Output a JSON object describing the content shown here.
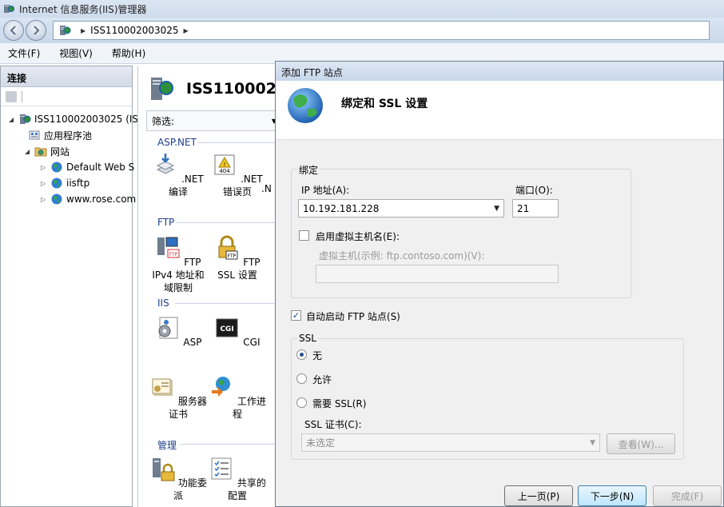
{
  "window": {
    "title": "Internet 信息服务(IIS)管理器"
  },
  "address": {
    "path": "ISS110002003025"
  },
  "menu": [
    "文件(F)",
    "视图(V)",
    "帮助(H)"
  ],
  "connections": {
    "header": "连接",
    "tree": [
      {
        "label": "ISS110002003025 (IS",
        "icon": "server-icon",
        "level": 0,
        "expander": "expanded"
      },
      {
        "label": "应用程序池",
        "icon": "app-pool-icon",
        "level": 1,
        "expander": "none"
      },
      {
        "label": "网站",
        "icon": "sites-folder-icon",
        "level": 1,
        "expander": "expanded"
      },
      {
        "label": "Default Web S",
        "icon": "globe-icon",
        "level": 2,
        "expander": "collapsed"
      },
      {
        "label": "iisftp",
        "icon": "globe-icon",
        "level": 2,
        "expander": "collapsed"
      },
      {
        "label": "www.rose.com",
        "icon": "globe-icon",
        "level": 2,
        "expander": "collapsed"
      }
    ]
  },
  "center": {
    "title": "ISS1100020",
    "filter_label": "筛选:",
    "groups": [
      {
        "label": "ASP.NET",
        "items": [
          ".NET 编译",
          ".NET 错误页",
          ".N"
        ]
      },
      {
        "label": "FTP",
        "items": [
          "FTP IPv4 地址和域限制",
          "FTP SSL 设置"
        ]
      },
      {
        "label": "IIS",
        "items": [
          "ASP",
          "CGI",
          "服务器证书",
          "工作进程"
        ]
      },
      {
        "label": "管理",
        "items": [
          "功能委派",
          "共享的配置"
        ]
      }
    ]
  },
  "dialog": {
    "title": "添加 FTP 站点",
    "header": "绑定和 SSL 设置",
    "binding": {
      "legend": "绑定",
      "ip_label": "IP 地址(A):",
      "ip_value": "10.192.181.228",
      "port_label": "端口(O):",
      "port_value": "21",
      "virtual_host_checkbox": "启用虚拟主机名(E):",
      "virtual_host_checked": false,
      "virtual_host_label": "虚拟主机(示例: ftp.contoso.com)(V):",
      "virtual_host_value": ""
    },
    "autostart_label": "自动启动 FTP 站点(S)",
    "autostart_checked": true,
    "ssl": {
      "legend": "SSL",
      "options": [
        "无",
        "允许",
        "需要 SSL(R)"
      ],
      "selected": 0,
      "cert_label": "SSL 证书(C):",
      "cert_value": "未选定",
      "view_button": "查看(W)..."
    },
    "buttons": {
      "prev": "上一页(P)",
      "next": "下一步(N)",
      "finish": "完成(F)"
    }
  }
}
